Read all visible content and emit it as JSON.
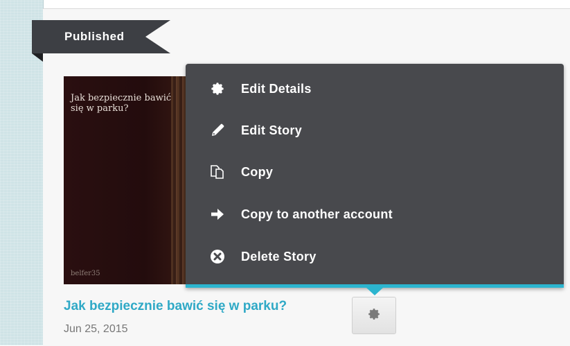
{
  "status_ribbon": {
    "label": "Published"
  },
  "cover": {
    "title": "Jak bezpiecznie bawić się w parku?",
    "author": "belfer35"
  },
  "menu": {
    "items": [
      {
        "label": "Edit Details",
        "icon": "gear-icon"
      },
      {
        "label": "Edit Story",
        "icon": "pencil-icon"
      },
      {
        "label": "Copy",
        "icon": "copy-icon"
      },
      {
        "label": "Copy to another account",
        "icon": "arrow-right-icon"
      },
      {
        "label": "Delete Story",
        "icon": "delete-circle-icon"
      }
    ]
  },
  "story": {
    "title": "Jak bezpiecznie bawić się w parku?",
    "date": "Jun 25, 2015"
  },
  "colors": {
    "accent": "#2cb5cf",
    "menu_bg": "#48494d",
    "ribbon_bg": "#3d3f44",
    "title_link": "#2fa9c6"
  }
}
